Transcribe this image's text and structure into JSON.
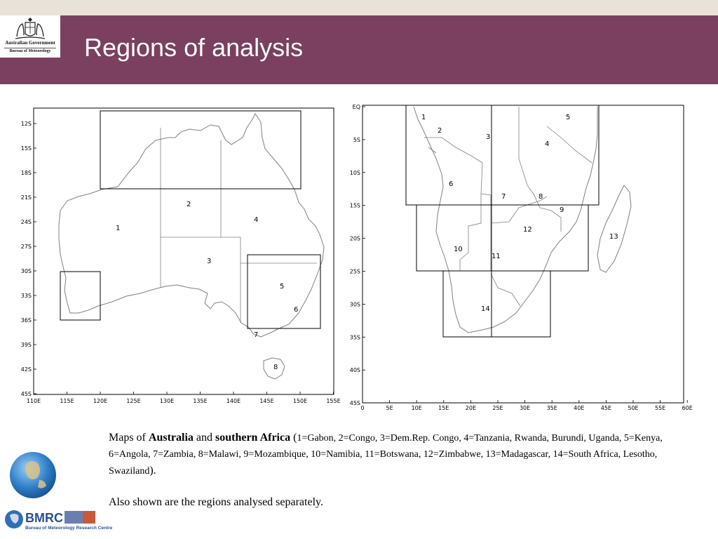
{
  "header": {
    "title": "Regions of analysis",
    "logo_line1": "Australian Government",
    "logo_line2": "Bureau of Meteorology"
  },
  "australia_map": {
    "lat_ticks": [
      "12S",
      "15S",
      "18S",
      "21S",
      "24S",
      "27S",
      "30S",
      "33S",
      "36S",
      "39S",
      "42S",
      "45S"
    ],
    "lon_ticks": [
      "110E",
      "115E",
      "120E",
      "125E",
      "130E",
      "135E",
      "140E",
      "145E",
      "150E",
      "155E"
    ],
    "region_numbers": [
      "1",
      "2",
      "3",
      "4",
      "5",
      "6",
      "7",
      "8"
    ]
  },
  "africa_map": {
    "lat_ticks": [
      "EQ",
      "5S",
      "10S",
      "15S",
      "20S",
      "25S",
      "30S",
      "35S",
      "40S",
      "45S"
    ],
    "lon_ticks": [
      "0",
      "5E",
      "10E",
      "15E",
      "20E",
      "25E",
      "30E",
      "35E",
      "40E",
      "45E",
      "50E",
      "55E",
      "60E"
    ],
    "region_numbers": [
      "1",
      "2",
      "3",
      "4",
      "5",
      "6",
      "7",
      "8",
      "9",
      "10",
      "11",
      "12",
      "13",
      "14"
    ]
  },
  "caption": {
    "prefix": "Maps of ",
    "australia": "Australia",
    "and": " and ",
    "southern_africa": "southern Africa",
    "open_paren": " (",
    "countries": "1=Gabon, 2=Congo, 3=Dem.Rep. Congo, 4=Tanzania, Rwanda, Burundi, Uganda, 5=Kenya, 6=Angola, 7=Zambia, 8=Malawi, 9=Mozambique, 10=Namibia, 11=Botswana, 12=Zimbabwe, 13=Madagascar, 14=South Africa, Lesotho, Swaziland",
    "close_paren": ").",
    "line2": "Also shown are the regions analysed separately."
  },
  "footer": {
    "bmrc_logo_text": "BMRC",
    "bmrc_subtitle": "Bureau of Meteorology Research Centre"
  }
}
